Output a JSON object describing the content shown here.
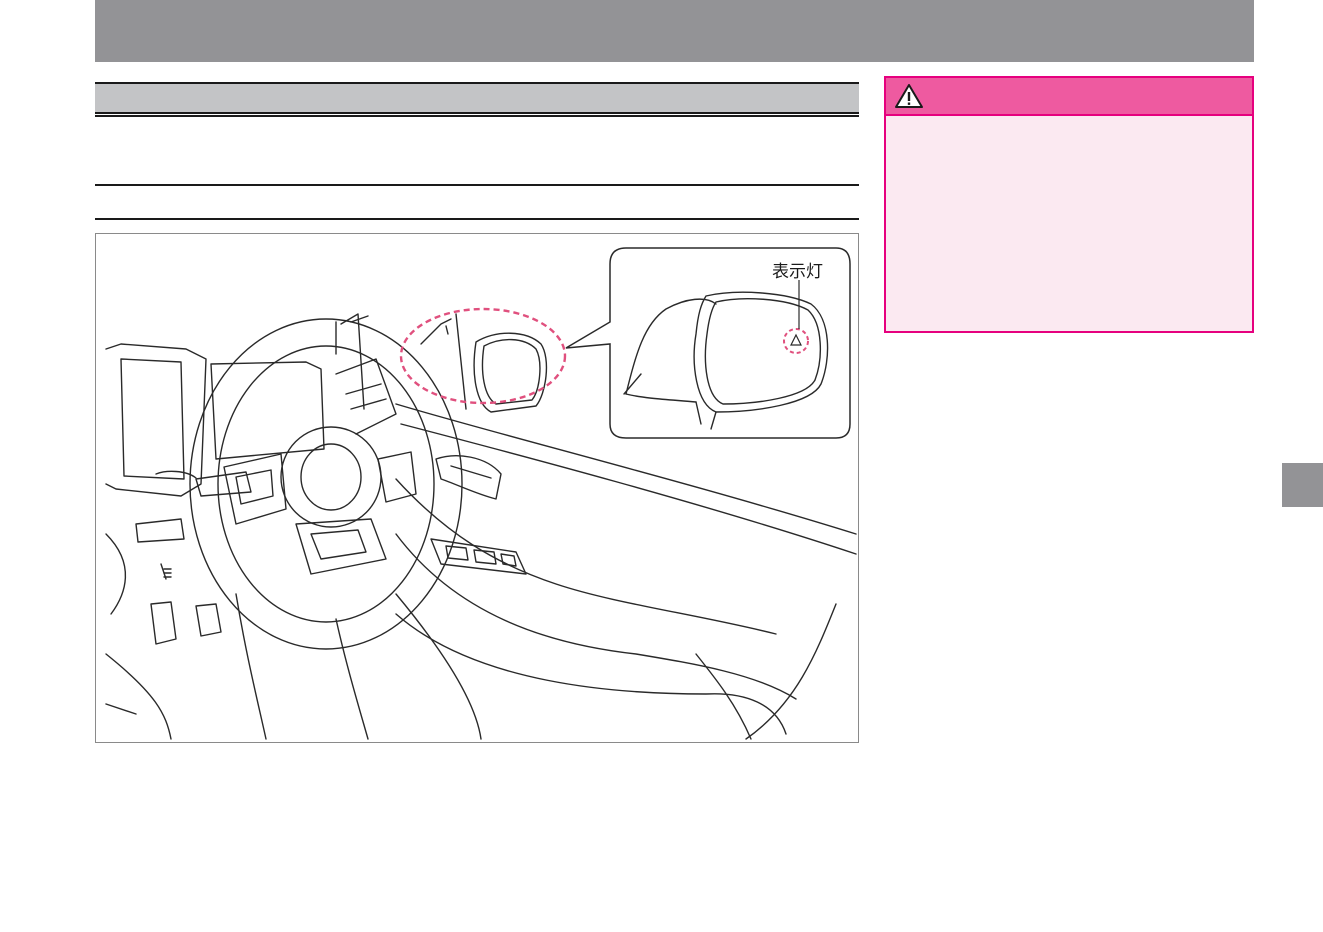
{
  "figure": {
    "callout_label": "表示灯"
  },
  "warning": {
    "icon": "warning-triangle-icon",
    "header_color": "#ee5aa0",
    "border_color": "#e6007e",
    "body_color": "#fbe9f1"
  },
  "colors": {
    "header_band": "#939396",
    "section_bar": "#c3c4c6",
    "side_tab": "#939396",
    "highlight_dash": "#e0507e"
  }
}
